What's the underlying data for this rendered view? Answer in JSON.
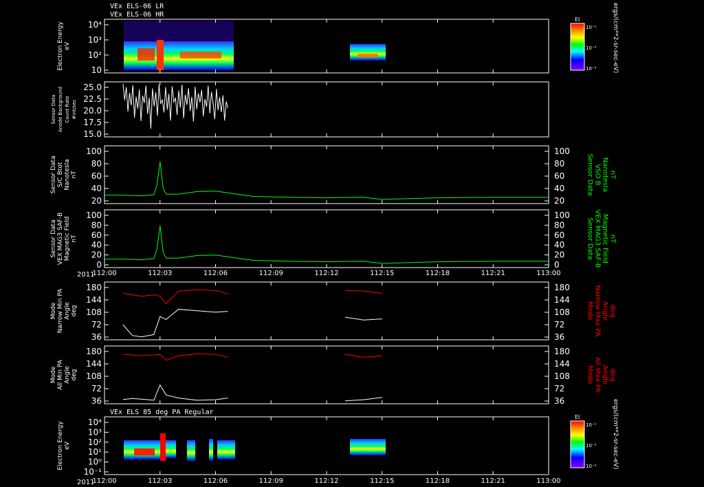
{
  "header": {
    "line1": "VEx ELS-06 LR",
    "line2": "VEx ELS-06 HR",
    "bottom_title": "VEx ELS 85 deg PA Regular",
    "year": "2011"
  },
  "colors": {
    "frame": "#ffffff",
    "green": "#00ff00",
    "red": "#ff0000",
    "white": "#ffffff"
  },
  "time_ticks": [
    "112:00",
    "112:03",
    "112:06",
    "112:09",
    "112:12",
    "112:15",
    "112:18",
    "112:21",
    "113:00"
  ],
  "colorbar": {
    "label": "EI",
    "units": "ergs/(cm**2-sr-sec-eV)",
    "ticks": [
      "10⁻¹",
      "10⁻⁵",
      "10⁻⁹"
    ]
  },
  "panels": {
    "p1": {
      "ylabel": [
        "Electron Energy",
        "eV"
      ],
      "ticks": [
        "10⁴",
        "10³",
        "10²",
        "10"
      ]
    },
    "p2": {
      "ylabel": [
        "Sensor Data",
        "Anode Background",
        "Count Rate",
        "#int/sec"
      ],
      "ticks": [
        "25.0",
        "22.5",
        "20.0",
        "17.5",
        "15.0"
      ]
    },
    "p3": {
      "ylabel": [
        "Sensor Data",
        "S/C Btot",
        "Nanotesla",
        "nT"
      ],
      "ticks": [
        "100",
        "80",
        "60",
        "40",
        "20"
      ],
      "rlabel": [
        "Sensor Data",
        "VSO B",
        "Nanotesla",
        "nT"
      ]
    },
    "p4": {
      "ylabel": [
        "Sensor Data",
        "VEX MAG3 SAF-B",
        "Magnetic Field",
        "nT"
      ],
      "ticks": [
        "100",
        "80",
        "60",
        "40",
        "20",
        "0"
      ],
      "rlabel": [
        "Sensor Data",
        "VEX MAG3 SAF-B",
        "Magnetic Field",
        "nT"
      ]
    },
    "p5": {
      "ylabel": [
        "Mode",
        "Narrow Min PA",
        "Angle",
        "deg"
      ],
      "ticks": [
        "180",
        "144",
        "108",
        "72",
        "36"
      ],
      "rlabel": [
        "Mode",
        "Narrow Max PA",
        "Angle",
        "deg"
      ]
    },
    "p6": {
      "ylabel": [
        "Mode",
        "All Min PA",
        "Angle",
        "deg"
      ],
      "ticks": [
        "180",
        "144",
        "108",
        "72",
        "36"
      ],
      "rlabel": [
        "Mode",
        "All Max PA",
        "Angle",
        "deg"
      ]
    },
    "p7": {
      "ylabel": [
        "Electron Energy",
        "eV"
      ],
      "ticks": [
        "10⁴",
        "10³",
        "10²",
        "10¹",
        "10⁰",
        "10⁻¹"
      ]
    }
  },
  "chart_data": [
    {
      "type": "heatmap",
      "title": "VEx ELS-06 LR / VEx ELS-06 HR",
      "ylabel": "Electron Energy eV",
      "scale": "log",
      "coverage": [
        [
          "112:01",
          "112:06:40"
        ],
        [
          "112:13",
          "112:15"
        ]
      ]
    },
    {
      "type": "line",
      "ylabel": "Sensor Data Anode Background Count Rate",
      "ylim": [
        13.5,
        25
      ],
      "x_range": [
        "112:01",
        "112:06:40"
      ],
      "values": [
        24.6,
        21.2,
        23.9,
        18.8,
        22.7,
        20.1,
        24.3,
        17.5,
        21.9,
        19.4,
        23.4,
        16.8,
        22.1,
        20.6,
        24.2,
        18.3,
        21.7,
        15.2,
        23.6,
        19.9,
        22.8,
        17.9,
        24.5,
        20.4,
        21.3,
        18.6,
        23.9,
        19.2,
        22.5,
        16.9,
        24.1,
        20.8,
        21.6,
        18.1,
        23.2,
        19.6,
        24.4,
        17.4,
        22.3,
        20.2,
        23.7,
        18.9,
        21.9,
        16.7,
        24.0,
        19.3,
        22.6,
        20.7,
        23.3,
        17.8,
        21.4,
        19.8,
        24.2,
        18.4,
        22.9,
        20.5,
        17.2,
        23.5,
        19.1,
        21.8,
        18.7,
        22.2,
        16.9,
        20.9,
        19.5
      ]
    },
    {
      "type": "line",
      "ylabel": "Sensor Data S/C Btot nT",
      "ylim": [
        0,
        100
      ],
      "x": [
        "112:00",
        "112:01",
        "112:02",
        "112:02:40",
        "112:02:50",
        "112:03",
        "112:03:10",
        "112:03:20",
        "112:04",
        "112:05",
        "112:06",
        "112:07",
        "112:08",
        "112:10",
        "112:12",
        "112:14",
        "112:15",
        "112:18",
        "112:21",
        "113:00"
      ],
      "values": [
        16,
        16,
        15,
        17,
        35,
        80,
        30,
        18,
        18,
        23,
        24,
        19,
        14,
        12,
        11,
        12,
        8,
        11,
        12,
        12
      ]
    },
    {
      "type": "line",
      "ylabel": "Sensor Data VEX MAG3 SAF-B Magnetic Field nT",
      "ylim": [
        0,
        100
      ],
      "x": [
        "112:00",
        "112:01",
        "112:02",
        "112:02:40",
        "112:02:50",
        "112:03",
        "112:03:10",
        "112:03:20",
        "112:04",
        "112:05",
        "112:06",
        "112:07",
        "112:08",
        "112:10",
        "112:12",
        "112:14",
        "112:15",
        "112:18",
        "112:21",
        "113:00"
      ],
      "values": [
        16,
        16,
        15,
        17,
        35,
        80,
        30,
        18,
        18,
        23,
        24,
        19,
        14,
        12,
        11,
        12,
        8,
        11,
        12,
        12
      ]
    },
    {
      "type": "line",
      "ylabel": "Mode Narrow Min/Max PA Angle deg",
      "ylim": [
        0,
        180
      ],
      "series": [
        {
          "name": "Narrow Min PA",
          "x": [
            "112:01",
            "112:01:30",
            "112:02",
            "112:02:40",
            "112:03",
            "112:03:20",
            "112:04",
            "112:05",
            "112:06",
            "112:06:40",
            "112:13",
            "112:14",
            "112:15"
          ],
          "values": [
            52,
            15,
            10,
            18,
            80,
            70,
            105,
            100,
            95,
            98,
            78,
            68,
            72
          ]
        },
        {
          "name": "Narrow Max PA",
          "x": [
            "112:01",
            "112:01:30",
            "112:02",
            "112:02:40",
            "112:03",
            "112:03:20",
            "112:04",
            "112:05",
            "112:06",
            "112:06:40",
            "112:13",
            "112:14",
            "112:15"
          ],
          "values": [
            160,
            155,
            150,
            155,
            150,
            125,
            168,
            172,
            170,
            158,
            170,
            168,
            160
          ]
        }
      ]
    },
    {
      "type": "line",
      "ylabel": "Mode All Min/Max PA Angle deg",
      "ylim": [
        0,
        180
      ],
      "series": [
        {
          "name": "All Min PA",
          "x": [
            "112:01",
            "112:01:30",
            "112:02",
            "112:02:40",
            "112:03",
            "112:03:20",
            "112:04",
            "112:05",
            "112:06",
            "112:06:40",
            "112:13",
            "112:14",
            "112:15"
          ],
          "values": [
            15,
            18,
            16,
            12,
            65,
            30,
            20,
            12,
            14,
            20,
            10,
            14,
            22
          ]
        },
        {
          "name": "All Max PA",
          "x": [
            "112:01",
            "112:01:30",
            "112:02",
            "112:02:40",
            "112:03",
            "112:03:20",
            "112:04",
            "112:05",
            "112:06",
            "112:06:40",
            "112:13",
            "112:14",
            "112:15"
          ],
          "values": [
            170,
            168,
            165,
            168,
            170,
            150,
            165,
            172,
            170,
            160,
            170,
            160,
            165
          ]
        }
      ]
    },
    {
      "type": "heatmap",
      "title": "VEx ELS 85 deg PA Regular",
      "ylabel": "Electron Energy eV",
      "scale": "log",
      "coverage": [
        [
          "112:01",
          "112:06:40"
        ],
        [
          "112:13",
          "112:15"
        ]
      ]
    }
  ]
}
